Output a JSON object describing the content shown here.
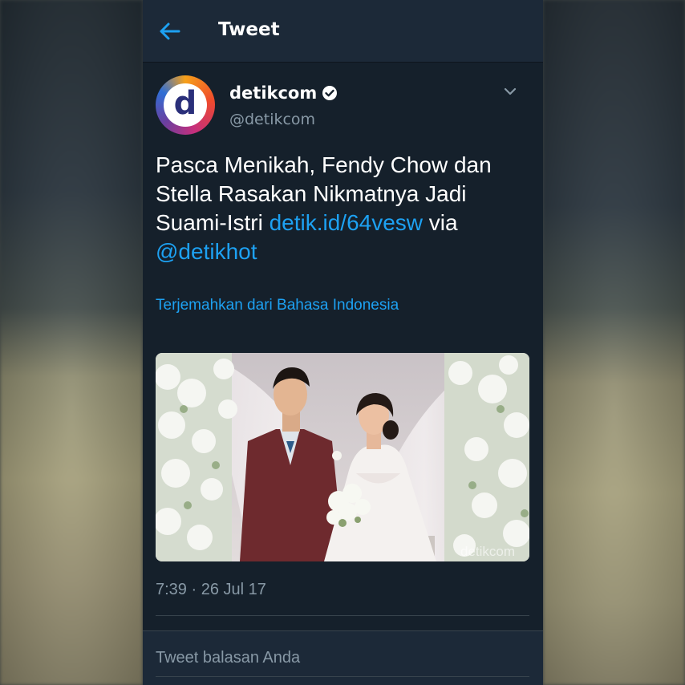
{
  "header": {
    "title": "Tweet"
  },
  "tweet": {
    "author": {
      "display_name": "detikcom",
      "handle": "@detikcom",
      "avatar_letter": "d",
      "verified": true
    },
    "text_plain": "Pasca Menikah, Fendy Chow dan Stella Rasakan Nikmatnya Jadi Suami-Istri ",
    "link": "detik.id/64vesw",
    "text_via": " via ",
    "mention": "@detikhot",
    "translate_label": "Terjemahkan dari Bahasa Indonesia",
    "media_watermark": "detikcom",
    "timestamp": "7:39 · 26 Jul 17"
  },
  "reply": {
    "placeholder": "Tweet balasan Anda"
  },
  "icons": {
    "back": "arrow-left-icon",
    "verified": "verified-badge-icon",
    "more": "chevron-down-icon"
  },
  "colors": {
    "accent": "#1da1f2",
    "background": "#15202b",
    "header_bg": "#1c2938",
    "secondary_text": "#8899a6"
  }
}
